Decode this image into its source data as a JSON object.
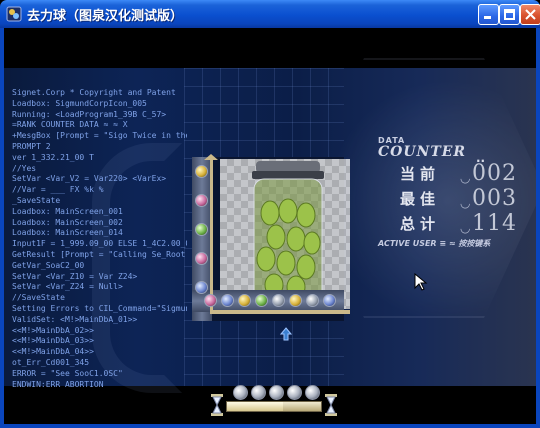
{
  "window": {
    "title": "去力球（图泉汉化测试版）"
  },
  "console_log": [
    "Signet.Corp * Copyright and Patent",
    "Loadbox: SigmundCorpIcon_005",
    "Running: <LoadProgram1_39B C_57>",
    "=RANK COUNTER DATA ≈ ≈ X",
    "+MesgBox [Prompt = \"Sigo Twice in the Riv",
    "PROMPT 2",
    "ver 1_332.21_00 T",
    "//Yes",
    "SetVar <Var_V2 = Var220> <VarEx>",
    "//Var = ___ FX %k %",
    "_SaveState",
    "Loadbox: MainScreen_001",
    "Loadbox: MainScreen_002",
    "Loadbox: MainScreen_014",
    "Input1F = 1_999.09_00 ELSE 1_4C2.00_00",
    "GetResult [Prompt = \"Calling Se_Root.int 5",
    "GetVar_SoaC2_00",
    "SetVar <Var_Z10 = Var Z24>",
    "SetVar <Var_Z24 = Null>",
    "//SaveState",
    "Setting Errors to CIL_Command=\"Sigmund",
    "ValidSet: <M!>MainDbA_01>>",
    "  <<M!>MainDbA_02>>",
    "  <<M!>MainDbA_03>>",
    "  <<M!>MainDbA_04>>",
    "ot_Err_Cd001_345",
    "ERROR = \"See SooC1.0SC\"",
    "ENDWIN:ERR_ABORTION",
    "END 00",
    "////END"
  ],
  "counter": {
    "header_small": "DATA",
    "header": "COUNTER",
    "header_suffix": "..",
    "rows": [
      {
        "label": "当前",
        "value": "002"
      },
      {
        "label": "最佳",
        "value": "003"
      },
      {
        "label": "总计",
        "value": "114"
      }
    ],
    "footer": "ACTIVE USER ≡ ≈ 按按键系"
  },
  "board": {
    "left_rail_balls": [
      "yellow",
      "pink",
      "green",
      "pink",
      "blue"
    ],
    "bottom_rail_balls": [
      "pink",
      "blue",
      "yellow",
      "green",
      "grey",
      "yellow",
      "grey",
      "blue"
    ]
  },
  "hud": {
    "lives": 5,
    "timer_fraction": 0.6
  },
  "colors": {
    "panel_blue": "#0d2456",
    "log_text": "#7fa2e8",
    "gold_rail": "#cbb98a",
    "counter_text": "#e4e7f0"
  }
}
